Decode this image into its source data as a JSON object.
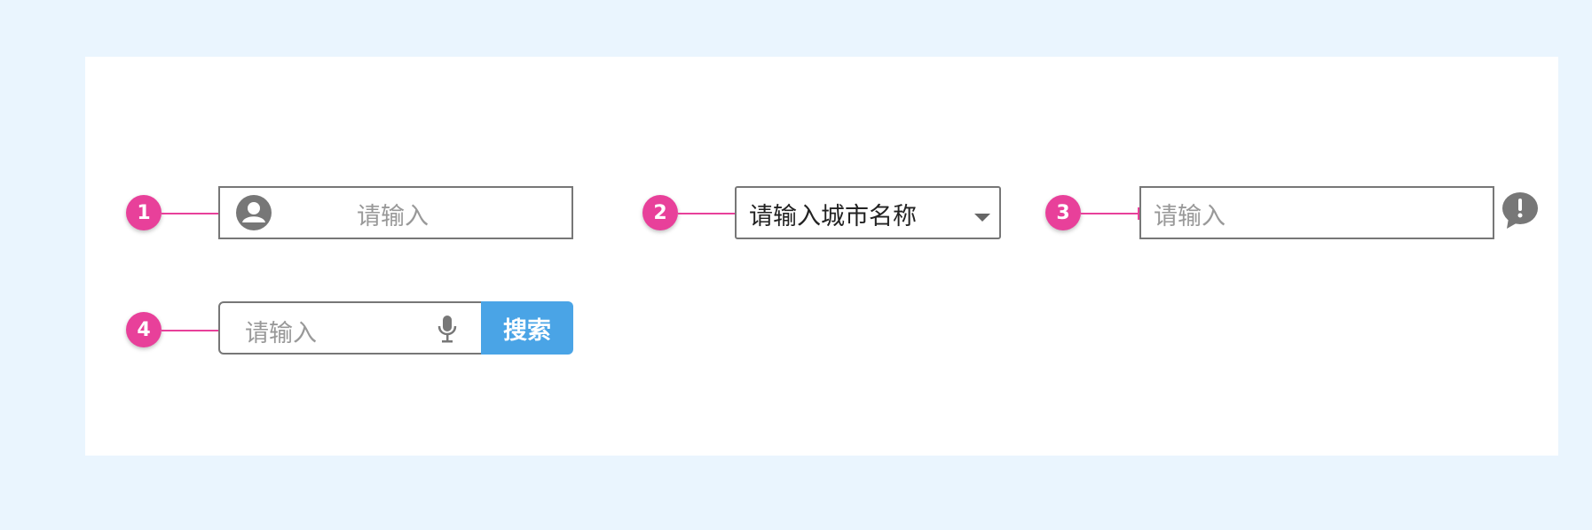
{
  "markers": [
    "1",
    "2",
    "3",
    "4"
  ],
  "field1": {
    "placeholder": "请输入",
    "icon": "user-avatar-icon"
  },
  "field2": {
    "value": "请输入城市名称",
    "icon": "caret-down-icon"
  },
  "field3": {
    "placeholder": "请输入",
    "icon": "exclamation-speech-bubble-icon"
  },
  "field4": {
    "placeholder": "请输入",
    "icon": "microphone-icon",
    "button_label": "搜索"
  },
  "colors": {
    "background": "#eaf5fe",
    "marker": "#e8409a",
    "border": "#777777",
    "button": "#4aa4e6",
    "icon": "#777777"
  }
}
